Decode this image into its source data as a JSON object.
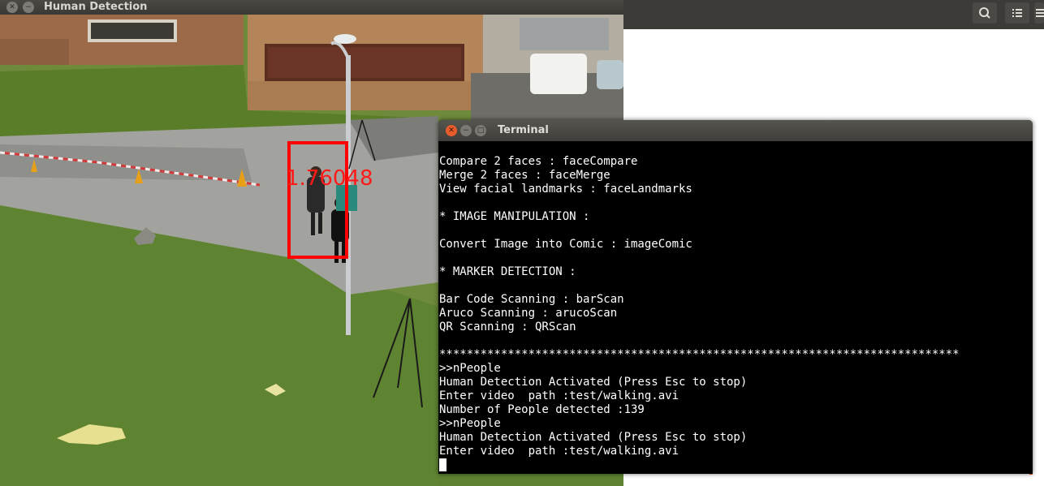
{
  "detection_window": {
    "title": "Human Detection",
    "box_label": "1.76048"
  },
  "terminal": {
    "title": "Terminal",
    "lines": [
      "Compare 2 faces : faceCompare",
      "Merge 2 faces : faceMerge",
      "View facial landmarks : faceLandmarks",
      "",
      "* IMAGE MANIPULATION :",
      "",
      "Convert Image into Comic : imageComic",
      "",
      "* MARKER DETECTION :",
      "",
      "Bar Code Scanning : barScan",
      "Aruco Scanning : arucoScan",
      "QR Scanning : QRScan",
      "",
      "****************************************************************************",
      ">>nPeople",
      "Human Detection Activated (Press Esc to stop)",
      "Enter video  path :test/walking.avi",
      "Number of People detected :139",
      ">>nPeople",
      "Human Detection Activated (Press Esc to stop)",
      "Enter video  path :test/walking.avi"
    ]
  },
  "topbar": {
    "icons": [
      "search-icon",
      "list-view-icon",
      "menu-icon"
    ]
  },
  "colors": {
    "detection_box": "#ff0000",
    "terminal_bg": "#000000",
    "terminal_text": "#ffffff",
    "close_button": "#e85c2b",
    "window_chrome": "#3c3b37"
  }
}
